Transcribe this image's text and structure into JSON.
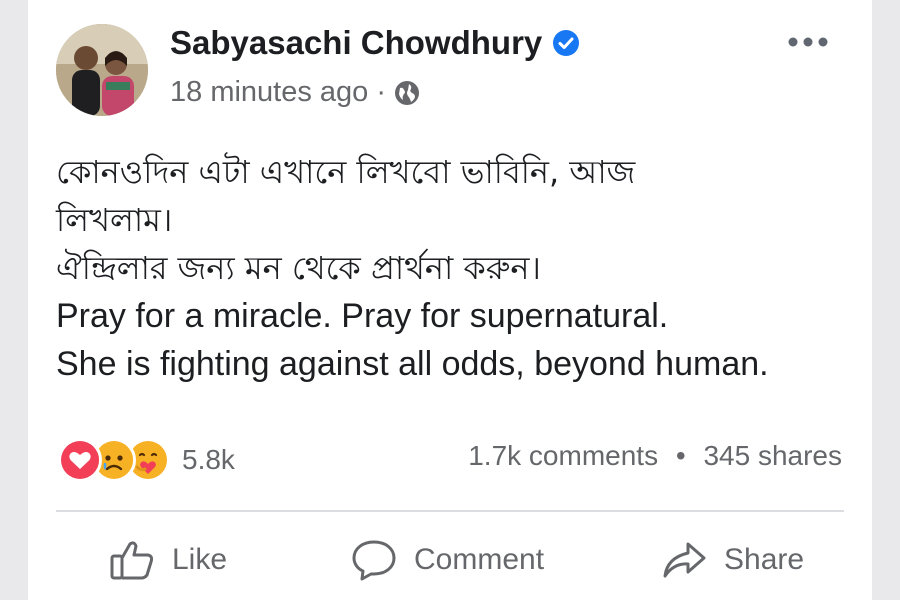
{
  "post": {
    "author": "Sabyasachi Chowdhury",
    "timestamp": "18 minutes ago",
    "meta_separator": "·",
    "text_lines": [
      "কোনওদিন এটা এখানে লিখবো ভাবিনি, আজ",
      "লিখলাম।",
      "ঐন্দ্রিলার জন্য মন থেকে প্রার্থনা করুন।",
      "Pray for a miracle. Pray for supernatural.",
      "She is fighting against all odds, beyond human."
    ]
  },
  "reactions": {
    "icons": [
      "love-reaction-icon",
      "sad-reaction-icon",
      "care-reaction-icon"
    ],
    "count": "5.8k"
  },
  "stats": {
    "comments": "1.7k comments",
    "separator": "•",
    "shares": "345 shares"
  },
  "actions": {
    "like": "Like",
    "comment": "Comment",
    "share": "Share"
  },
  "colors": {
    "verified": "#1877f2",
    "love": "#f33e58",
    "sad_face": "#f7b125",
    "text": "#1c1e21",
    "muted": "#65676b"
  }
}
